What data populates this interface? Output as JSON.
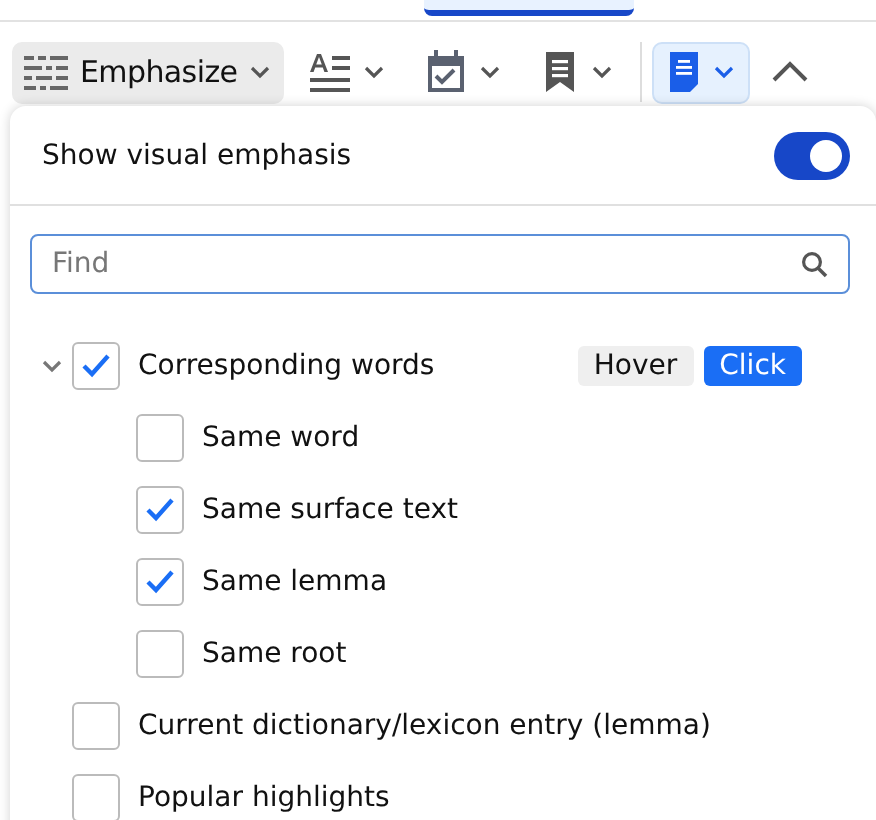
{
  "toolbar": {
    "emphasize": {
      "label": "Emphasize",
      "open": true
    },
    "tools": [
      {
        "selected": false
      },
      {
        "selected": false
      },
      {
        "selected": false
      },
      {
        "selected": true
      }
    ]
  },
  "panel": {
    "toggle": {
      "label": "Show visual emphasis",
      "on": true
    },
    "search": {
      "placeholder": "Find"
    },
    "modes": [
      {
        "label": "Hover",
        "selected": false
      },
      {
        "label": "Click",
        "selected": true
      }
    ],
    "options": [
      {
        "label": "Corresponding words",
        "checked": true,
        "expanded": true,
        "children": [
          {
            "label": "Same word",
            "checked": false
          },
          {
            "label": "Same surface text",
            "checked": true
          },
          {
            "label": "Same lemma",
            "checked": true
          },
          {
            "label": "Same root",
            "checked": false
          }
        ]
      },
      {
        "label": "Current dictionary/lexicon entry (lemma)",
        "checked": false
      },
      {
        "label": "Popular highlights",
        "checked": false
      }
    ]
  }
}
